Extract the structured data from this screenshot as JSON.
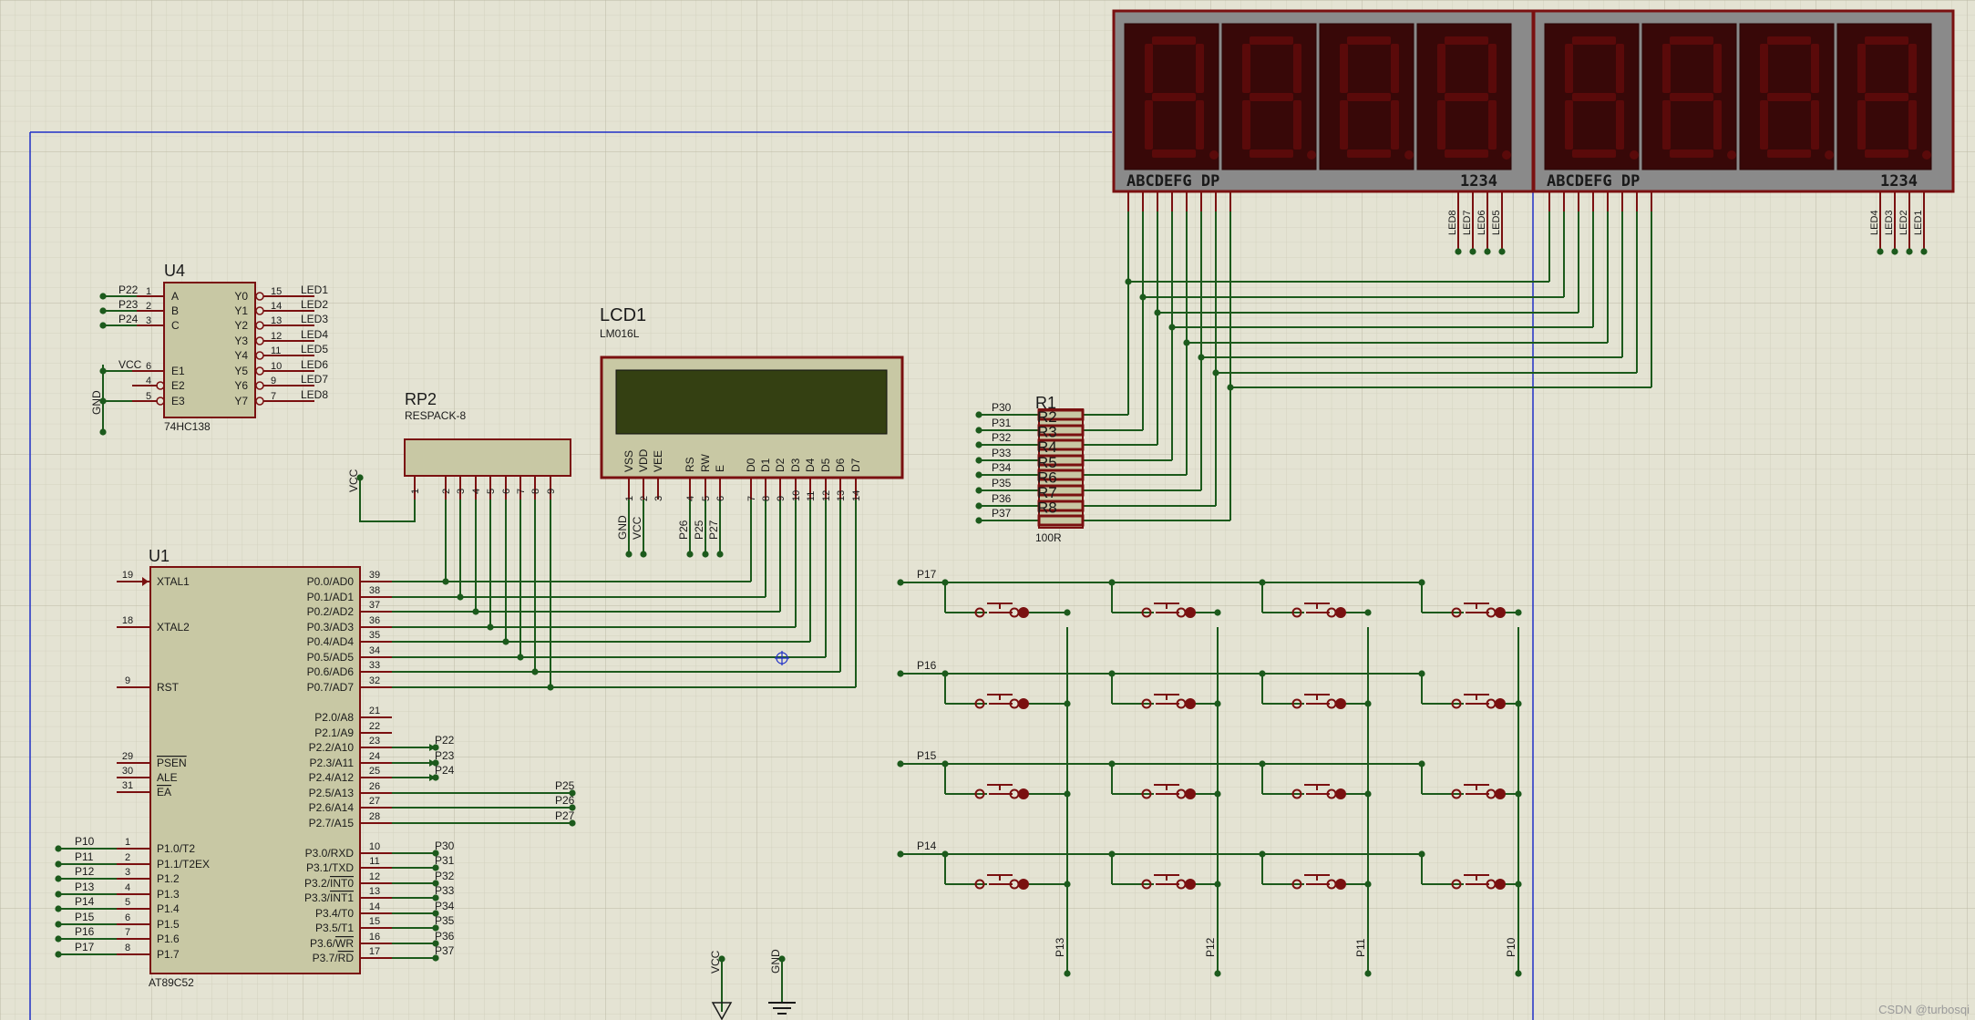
{
  "watermark": "CSDN @turbosqi",
  "u4": {
    "ref": "U4",
    "part": "74HC138",
    "left_pins": [
      {
        "net": "P22",
        "num": "1",
        "name": "A"
      },
      {
        "net": "P23",
        "num": "2",
        "name": "B"
      },
      {
        "net": "P24",
        "num": "3",
        "name": "C"
      },
      {
        "net": "VCC",
        "num": "6",
        "name": "E1"
      },
      {
        "net": "",
        "num": "4",
        "name": "E2"
      },
      {
        "net": "",
        "num": "5",
        "name": "E3"
      }
    ],
    "right_pins": [
      {
        "name": "Y0",
        "num": "15",
        "net": "LED1"
      },
      {
        "name": "Y1",
        "num": "14",
        "net": "LED2"
      },
      {
        "name": "Y2",
        "num": "13",
        "net": "LED3"
      },
      {
        "name": "Y3",
        "num": "12",
        "net": "LED4"
      },
      {
        "name": "Y4",
        "num": "11",
        "net": "LED5"
      },
      {
        "name": "Y5",
        "num": "10",
        "net": "LED6"
      },
      {
        "name": "Y6",
        "num": "9",
        "net": "LED7"
      },
      {
        "name": "Y7",
        "num": "7",
        "net": "LED8"
      }
    ],
    "gnd": "GND"
  },
  "rp2": {
    "ref": "RP2",
    "part": "RESPACK-8",
    "vcc": "VCC",
    "pins": [
      "1",
      "2",
      "3",
      "4",
      "5",
      "6",
      "7",
      "8",
      "9"
    ]
  },
  "lcd": {
    "ref": "LCD1",
    "part": "LM016L",
    "pins": [
      {
        "name": "VSS",
        "num": "1"
      },
      {
        "name": "VDD",
        "num": "2"
      },
      {
        "name": "VEE",
        "num": "3"
      },
      {
        "name": "RS",
        "num": "4"
      },
      {
        "name": "RW",
        "num": "5"
      },
      {
        "name": "E",
        "num": "6"
      },
      {
        "name": "D0",
        "num": "7"
      },
      {
        "name": "D1",
        "num": "8"
      },
      {
        "name": "D2",
        "num": "9"
      },
      {
        "name": "D3",
        "num": "10"
      },
      {
        "name": "D4",
        "num": "11"
      },
      {
        "name": "D5",
        "num": "12"
      },
      {
        "name": "D6",
        "num": "13"
      },
      {
        "name": "D7",
        "num": "14"
      }
    ],
    "nets": [
      "GND",
      "VCC",
      "P26",
      "P25",
      "P27"
    ]
  },
  "u1": {
    "ref": "U1",
    "part": "AT89C52",
    "left_pins": [
      {
        "num": "19",
        "name": "XTAL1",
        "net": ""
      },
      {
        "num": "18",
        "name": "XTAL2",
        "net": ""
      },
      {
        "num": "9",
        "name": "RST",
        "net": ""
      },
      {
        "num": "29",
        "name": "PSEN",
        "net": ""
      },
      {
        "num": "30",
        "name": "ALE",
        "net": ""
      },
      {
        "num": "31",
        "name": "EA",
        "net": ""
      },
      {
        "num": "1",
        "name": "P1.0/T2",
        "net": "P10"
      },
      {
        "num": "2",
        "name": "P1.1/T2EX",
        "net": "P11"
      },
      {
        "num": "3",
        "name": "P1.2",
        "net": "P12"
      },
      {
        "num": "4",
        "name": "P1.3",
        "net": "P13"
      },
      {
        "num": "5",
        "name": "P1.4",
        "net": "P14"
      },
      {
        "num": "6",
        "name": "P1.5",
        "net": "P15"
      },
      {
        "num": "7",
        "name": "P1.6",
        "net": "P16"
      },
      {
        "num": "8",
        "name": "P1.7",
        "net": "P17"
      }
    ],
    "right_pins": [
      {
        "num": "39",
        "name": "P0.0/AD0",
        "net": ""
      },
      {
        "num": "38",
        "name": "P0.1/AD1",
        "net": ""
      },
      {
        "num": "37",
        "name": "P0.2/AD2",
        "net": ""
      },
      {
        "num": "36",
        "name": "P0.3/AD3",
        "net": ""
      },
      {
        "num": "35",
        "name": "P0.4/AD4",
        "net": ""
      },
      {
        "num": "34",
        "name": "P0.5/AD5",
        "net": ""
      },
      {
        "num": "33",
        "name": "P0.6/AD6",
        "net": ""
      },
      {
        "num": "32",
        "name": "P0.7/AD7",
        "net": ""
      },
      {
        "num": "21",
        "name": "P2.0/A8",
        "net": ""
      },
      {
        "num": "22",
        "name": "P2.1/A9",
        "net": ""
      },
      {
        "num": "23",
        "name": "P2.2/A10",
        "net": "P22"
      },
      {
        "num": "24",
        "name": "P2.3/A11",
        "net": "P23"
      },
      {
        "num": "25",
        "name": "P2.4/A12",
        "net": "P24"
      },
      {
        "num": "26",
        "name": "P2.5/A13",
        "net": "P25"
      },
      {
        "num": "27",
        "name": "P2.6/A14",
        "net": "P26"
      },
      {
        "num": "28",
        "name": "P2.7/A15",
        "net": "P27"
      },
      {
        "num": "10",
        "name": "P3.0/RXD",
        "net": "P30"
      },
      {
        "num": "11",
        "name": "P3.1/TXD",
        "net": "P31"
      },
      {
        "num": "12",
        "name": "P3.2/INT0",
        "net": "P32"
      },
      {
        "num": "13",
        "name": "P3.3/INT1",
        "net": "P33"
      },
      {
        "num": "14",
        "name": "P3.4/T0",
        "net": "P34"
      },
      {
        "num": "15",
        "name": "P3.5/T1",
        "net": "P35"
      },
      {
        "num": "16",
        "name": "P3.6/WR",
        "net": "P36"
      },
      {
        "num": "17",
        "name": "P3.7/RD",
        "net": "P37"
      }
    ]
  },
  "r1": {
    "ref": "R1",
    "value": "100R",
    "resistors": [
      "R2",
      "R3",
      "R4",
      "R5",
      "R6",
      "R7",
      "R8"
    ],
    "nets": [
      "P30",
      "P31",
      "P32",
      "P33",
      "P34",
      "P35",
      "P36",
      "P37"
    ]
  },
  "seg": {
    "segment_label": "ABCDEFG DP",
    "digit_label": "1234",
    "digit_color": "#5a0a0a",
    "left_commons": [
      "LED8",
      "LED7",
      "LED6",
      "LED5"
    ],
    "right_commons": [
      "LED4",
      "LED3",
      "LED2",
      "LED1"
    ]
  },
  "keypad": {
    "rows": [
      "P17",
      "P16",
      "P15",
      "P14"
    ],
    "cols": [
      "P13",
      "P12",
      "P11",
      "P10"
    ]
  },
  "power": {
    "vcc": "VCC",
    "gnd": "GND"
  }
}
